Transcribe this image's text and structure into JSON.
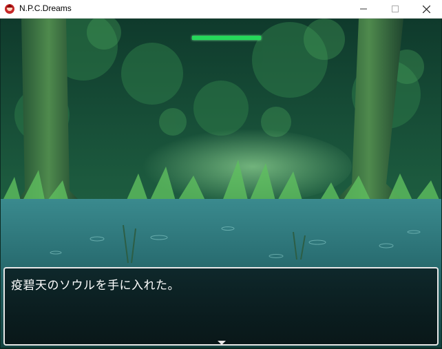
{
  "window": {
    "title": "N.P.C.Dreams",
    "icon": "app-icon",
    "controls": [
      "minimize-icon",
      "maximize-icon",
      "close-icon"
    ]
  },
  "scene": {
    "setting": "forest-pond",
    "hp_bar": {
      "fill": 1.0,
      "color": "#25d85a"
    }
  },
  "message": {
    "text": "疫碧天のソウルを手に入れた。",
    "continue_indicator": "down-triangle-icon"
  }
}
